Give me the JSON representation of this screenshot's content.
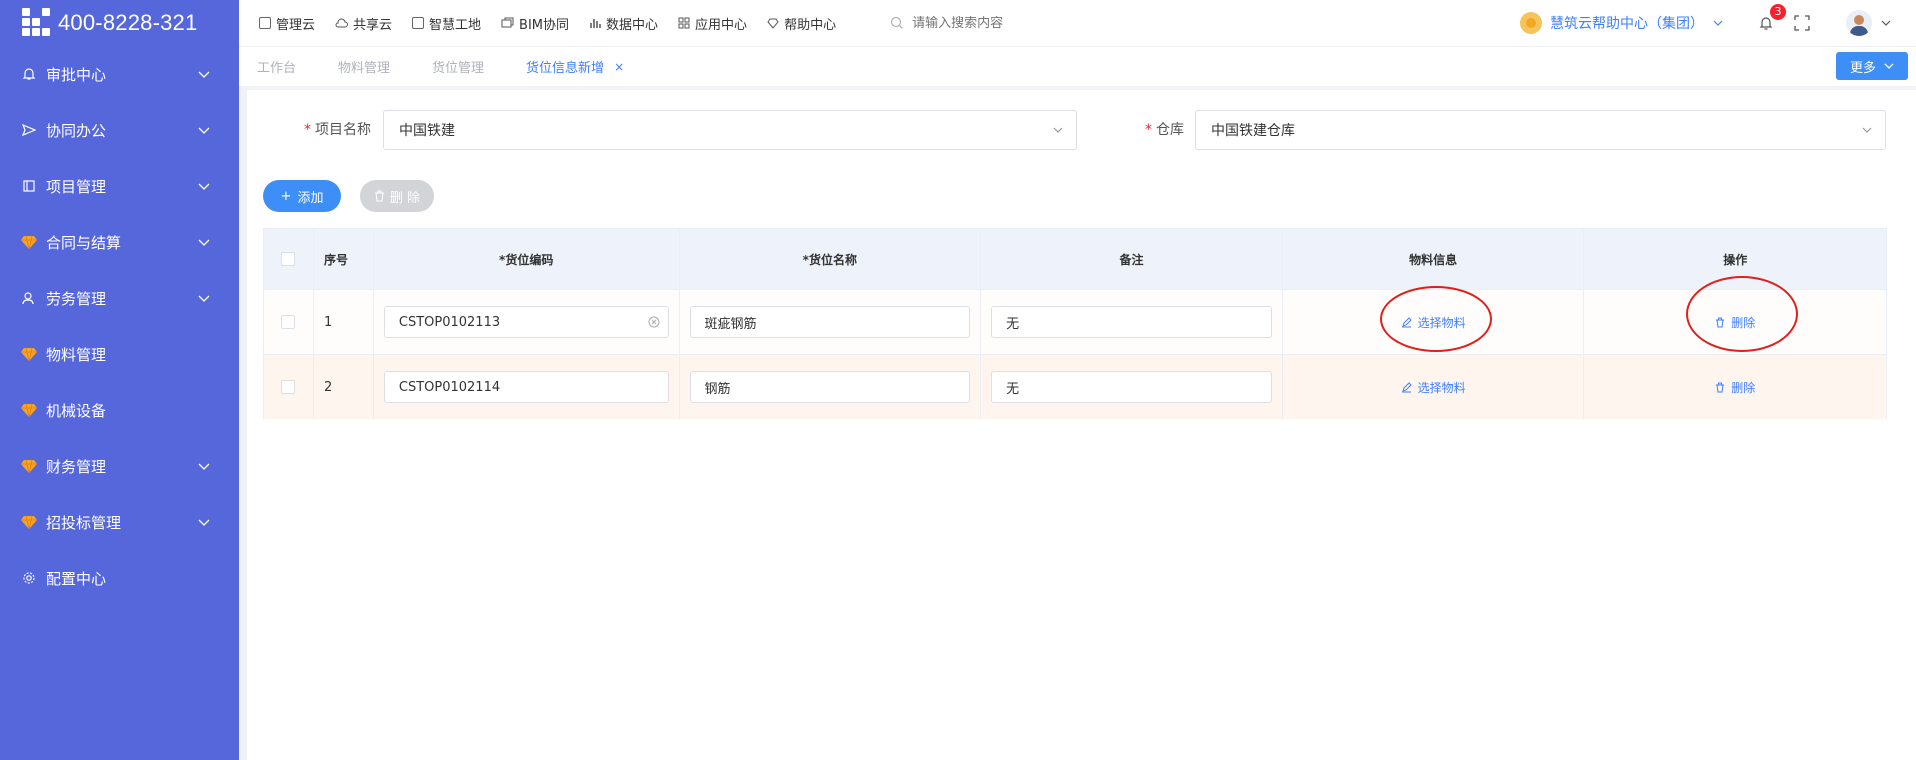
{
  "brand": {
    "phone": "400-8228-321"
  },
  "sidebar": {
    "items": [
      {
        "label": "审批中心",
        "icon": "bell-icon",
        "has_children": true
      },
      {
        "label": "协同办公",
        "icon": "send-icon",
        "has_children": true
      },
      {
        "label": "项目管理",
        "icon": "book-icon",
        "has_children": true
      },
      {
        "label": "合同与结算",
        "icon": "gem-icon",
        "has_children": true
      },
      {
        "label": "劳务管理",
        "icon": "user-icon",
        "has_children": true
      },
      {
        "label": "物料管理",
        "icon": "gem-icon",
        "has_children": false
      },
      {
        "label": "机械设备",
        "icon": "gem-icon",
        "has_children": false
      },
      {
        "label": "财务管理",
        "icon": "gem-icon",
        "has_children": true
      },
      {
        "label": "招投标管理",
        "icon": "gem-icon",
        "has_children": true
      },
      {
        "label": "配置中心",
        "icon": "gear-icon",
        "has_children": false
      }
    ]
  },
  "topnav": {
    "items": [
      "管理云",
      "共享云",
      "智慧工地",
      "BIM协同",
      "数据中心",
      "应用中心",
      "帮助中心"
    ],
    "search_placeholder": "请输入搜索内容",
    "help_center": "慧筑云帮助中心（集团）",
    "notification_count": "3"
  },
  "tabs": {
    "items": [
      {
        "label": "工作台",
        "active": false
      },
      {
        "label": "物料管理",
        "active": false
      },
      {
        "label": "货位管理",
        "active": false
      },
      {
        "label": "货位信息新增",
        "active": true,
        "closable": true
      }
    ],
    "close_glyph": "×",
    "more_label": "更多"
  },
  "form": {
    "project_label": "项目名称",
    "project_value": "中国铁建",
    "warehouse_label": "仓库",
    "warehouse_value": "中国铁建仓库",
    "required_mark": "*"
  },
  "actions": {
    "add_label": "添加",
    "delete_label": "删 除",
    "add_glyph": "+"
  },
  "table": {
    "columns": [
      "序号",
      "*货位编码",
      "*货位名称",
      "备注",
      "物料信息",
      "操作"
    ],
    "rows": [
      {
        "no": "1",
        "code": "CSTOP0102113",
        "name": "斑疵钢筋",
        "note": "无",
        "material_action": "选择物料",
        "op_action": "删除"
      },
      {
        "no": "2",
        "code": "CSTOP0102114",
        "name": "钢筋",
        "note": "无",
        "material_action": "选择物料",
        "op_action": "删除"
      }
    ]
  },
  "colors": {
    "sidebar": "#5667dc",
    "accent": "#3e7fff",
    "annotation": "#e0201b"
  }
}
